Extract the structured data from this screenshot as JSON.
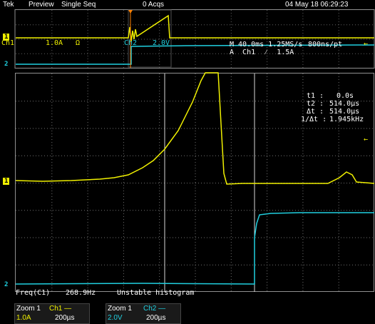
{
  "topbar": {
    "brand": "Tek",
    "mode": "Preview",
    "sequence": "Single Seq",
    "acqs": "0 Acqs",
    "datetime": "04 May 18 06:29:23"
  },
  "overview": {
    "ch1_label": "Ch1",
    "ch1_scale": "1.0A",
    "ch1_coupling": "Ω",
    "ch2_label": "Ch2",
    "ch2_scale": "2.0V",
    "timebase": "M 40.0ms 1.25MS/s",
    "resolution": "800ns/pt",
    "trigger": "A  Ch1  ⁄  1.5A"
  },
  "markers": {
    "ch1": "1",
    "ch2": "2",
    "ch1_zoom": "1",
    "ch2_zoom": "2"
  },
  "cursors": {
    "t1_label": "t1 :",
    "t1_value": "0.0s",
    "t2_label": "t2 :",
    "t2_value": "514.0µs",
    "dt_label": "Δt :",
    "dt_value": "514.0µs",
    "inv_label": "1/Δt :",
    "inv_value": "1.945kHz"
  },
  "measure": {
    "freq_label": "Freq(C1)",
    "freq_value": "268.9Hz",
    "status": "Unstable histogram"
  },
  "bottom": {
    "zoom1_label": "Zoom 1",
    "zoom1_ch": "Ch1 —",
    "zoom1_scale": "1.0A",
    "zoom1_time": "200µs",
    "zoom2_label": "Zoom 1",
    "zoom2_ch": "Ch2 —",
    "zoom2_scale": "2.0V",
    "zoom2_time": "200µs"
  },
  "colors": {
    "ch1": "#f0f000",
    "ch2": "#20d0e0",
    "grid": "#808080",
    "trigger": "#ff8000"
  }
}
